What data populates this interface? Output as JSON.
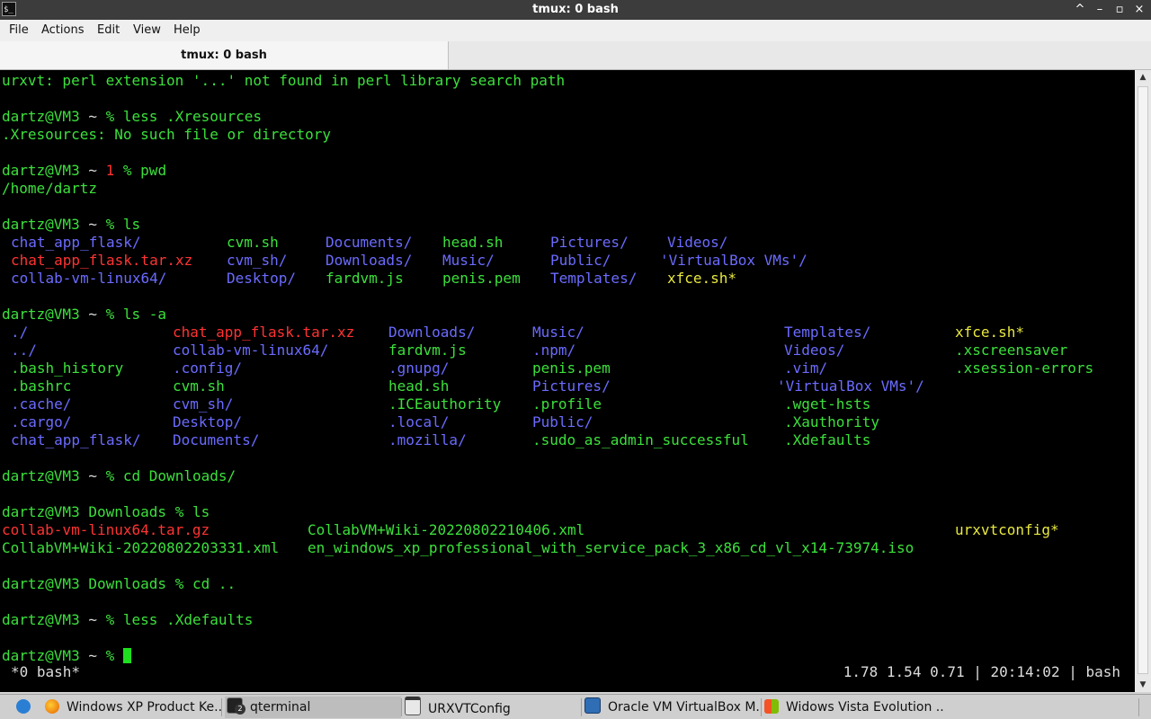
{
  "window": {
    "title": "tmux: 0 bash",
    "min_glyph": "^",
    "max_glyph": "–",
    "restore_glyph": "▫",
    "close_glyph": "×"
  },
  "menu": [
    "File",
    "Actions",
    "Edit",
    "View",
    "Help"
  ],
  "tab": {
    "label": "tmux: 0 bash"
  },
  "terminal": {
    "prompt_user": "dartz@VM3",
    "lines": {
      "l1": "urxvt: perl extension '...' not found in perl library search path",
      "l2_dir": "~",
      "l2_cmd": "% less .Xresources",
      "l3": ".Xresources: No such file or directory",
      "l4_err": "1",
      "l4_cmd": "% pwd",
      "l5": "/home/dartz",
      "l6_cmd": "% ls",
      "l7_cmd": "% ls -a",
      "l8_cmd": "% cd Downloads/",
      "l9_dir": "Downloads",
      "l9_cmd": "% ls",
      "l10_cmd": "% cd ..",
      "l11_cmd": "% less .Xdefaults",
      "l12_cmd": "%"
    },
    "ls": [
      [
        "chat_app_flask/",
        "cvm.sh",
        "Documents/",
        "head.sh",
        "Pictures/",
        "Videos/"
      ],
      [
        "chat_app_flask.tar.xz",
        "cvm_sh/",
        "Downloads/",
        "Music/",
        "Public/",
        "'VirtualBox VMs'/"
      ],
      [
        "collab-vm-linux64/",
        "Desktop/",
        "fardvm.js",
        "penis.pem",
        "Templates/",
        "xfce.sh*"
      ]
    ],
    "ls_a": [
      [
        "./",
        "chat_app_flask.tar.xz",
        "Downloads/",
        "Music/",
        "Templates/",
        "xfce.sh*"
      ],
      [
        "../",
        "collab-vm-linux64/",
        "fardvm.js",
        ".npm/",
        "Videos/",
        ".xscreensaver"
      ],
      [
        ".bash_history",
        ".config/",
        ".gnupg/",
        "penis.pem",
        ".vim/",
        ".xsession-errors"
      ],
      [
        ".bashrc",
        "cvm.sh",
        "head.sh",
        "Pictures/",
        "'VirtualBox VMs'/",
        ""
      ],
      [
        ".cache/",
        "cvm_sh/",
        ".ICEauthority",
        ".profile",
        ".wget-hsts",
        ""
      ],
      [
        ".cargo/",
        "Desktop/",
        ".local/",
        "Public/",
        ".Xauthority",
        ""
      ],
      [
        "chat_app_flask/",
        "Documents/",
        ".mozilla/",
        ".sudo_as_admin_successful",
        ".Xdefaults",
        ""
      ]
    ],
    "ls_downloads": [
      [
        "collab-vm-linux64.tar.gz",
        "CollabVM+Wiki-20220802210406.xml",
        "urxvtconfig*"
      ],
      [
        "CollabVM+Wiki-20220802203331.xml",
        "en_windows_xp_professional_with_service_pack_3_x86_cd_vl_x14-73974.iso",
        ""
      ]
    ]
  },
  "status": {
    "left": "*0 bash*",
    "right": "1.78 1.54 0.71 | 20:14:02 | bash"
  },
  "taskbar": [
    "Windows XP Product Ke...",
    "qterminal",
    "URXVTConfig",
    "Oracle VM VirtualBox M...",
    "Widows Vista Evolution ..."
  ],
  "taskbar_badge": "2",
  "colors": {
    "green": "#3ce03c",
    "blue": "#6b6bff",
    "red": "#ff3333",
    "yellow": "#e8e840",
    "bg": "#000000"
  }
}
